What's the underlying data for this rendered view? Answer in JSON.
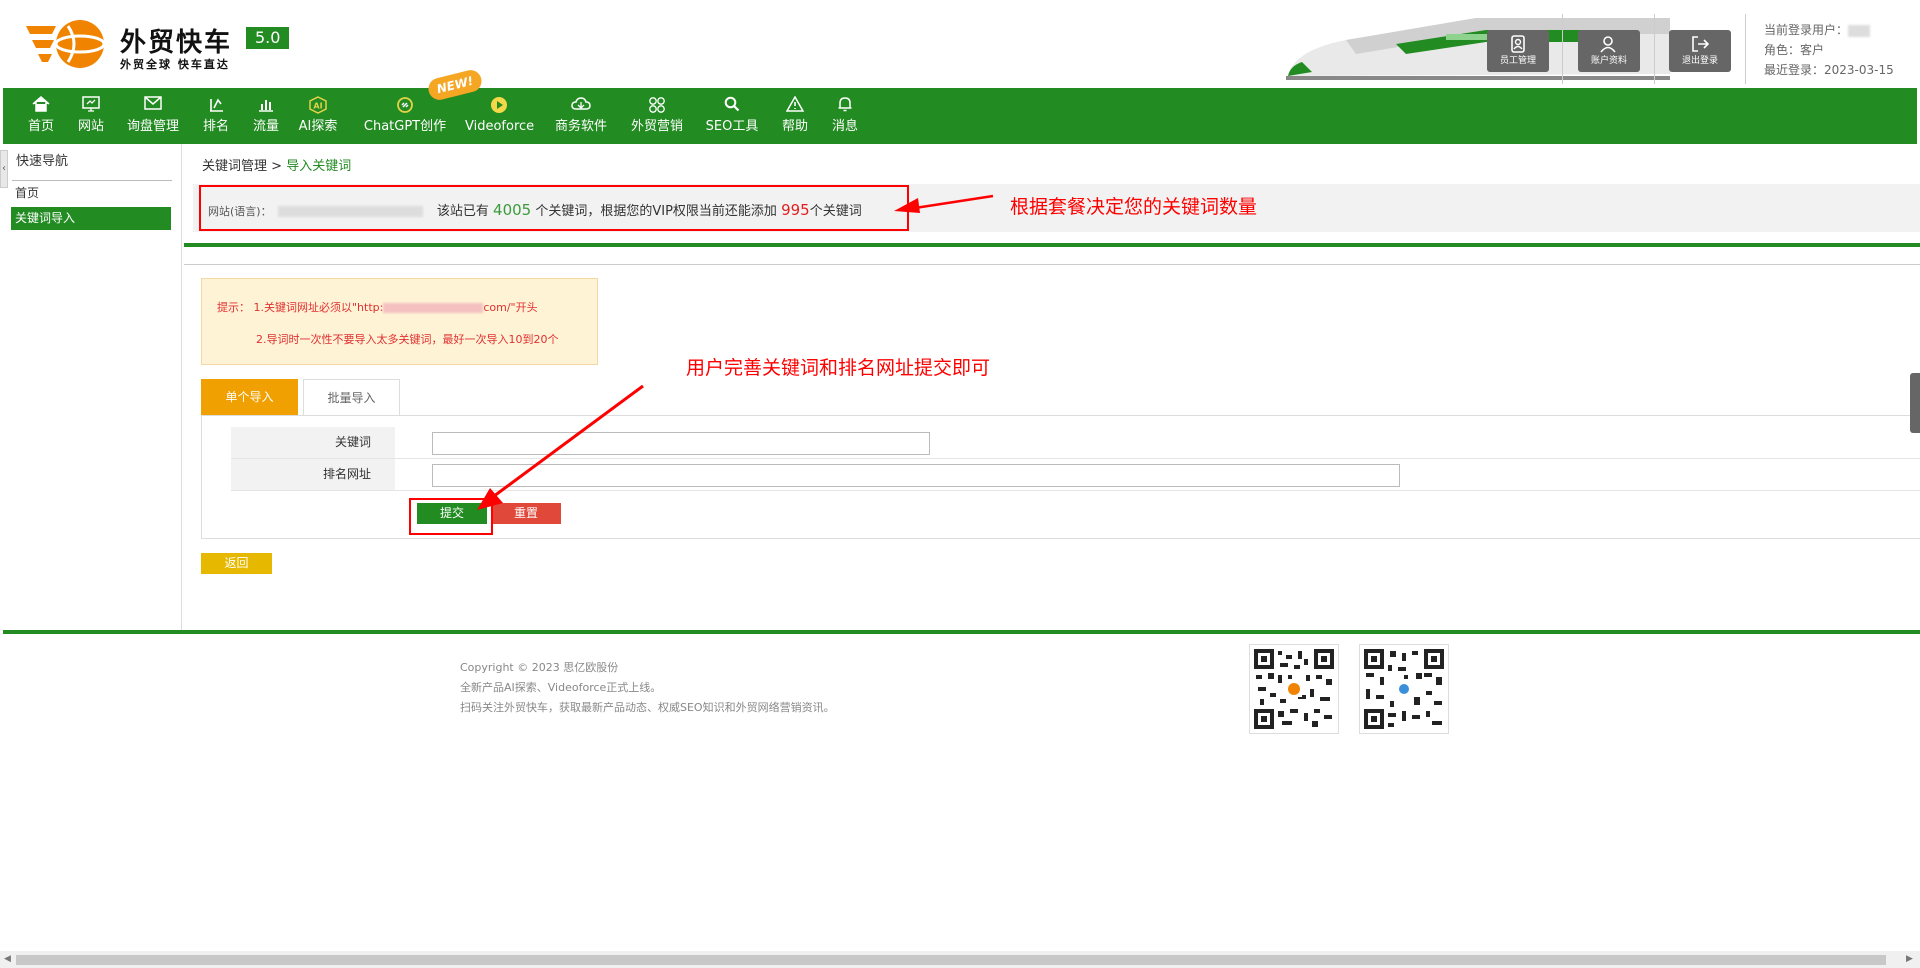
{
  "brand": {
    "name": "外贸快车",
    "tagline": "外贸全球 快车直达",
    "version": "5.0"
  },
  "header_buttons": [
    {
      "label": "员工管理",
      "icon": "staff-icon"
    },
    {
      "label": "账户资料",
      "icon": "user-icon"
    },
    {
      "label": "退出登录",
      "icon": "logout-icon"
    }
  ],
  "user_info": {
    "current_user_label": "当前登录用户：",
    "role_label": "角色：",
    "role": "客户",
    "last_login_label": "最近登录：",
    "last_login": "2023-03-15"
  },
  "nav": {
    "new_badge": "NEW!",
    "items": [
      {
        "label": "首页",
        "icon": "home-icon"
      },
      {
        "label": "网站",
        "icon": "monitor-icon"
      },
      {
        "label": "询盘管理",
        "icon": "mail-icon"
      },
      {
        "label": "排名",
        "icon": "ranking-icon"
      },
      {
        "label": "流量",
        "icon": "bar-chart-icon"
      },
      {
        "label": "AI探索",
        "icon": "ai-icon"
      },
      {
        "label": "ChatGPT创作",
        "icon": "chatgpt-icon"
      },
      {
        "label": "Videoforce",
        "icon": "play-icon"
      },
      {
        "label": "商务软件",
        "icon": "cloud-icon"
      },
      {
        "label": "外贸营销",
        "icon": "grid-icon"
      },
      {
        "label": "SEO工具",
        "icon": "search-icon"
      },
      {
        "label": "帮助",
        "icon": "warning-icon"
      },
      {
        "label": "消息",
        "icon": "bell-icon"
      }
    ]
  },
  "sidebar": {
    "title": "快速导航",
    "items": [
      {
        "label": "首页",
        "active": false
      },
      {
        "label": "关键词导入",
        "active": true
      }
    ]
  },
  "breadcrumb": {
    "parent": "关键词管理",
    "separator": ">",
    "current": "导入关键词"
  },
  "quota": {
    "site_label": "网站(语言)：",
    "text_before": "该站已有",
    "existing_count": "4005",
    "text_middle": "个关键词，根据您的VIP权限当前还能添加",
    "remaining_count": "995",
    "text_after": "个关键词"
  },
  "tips": {
    "line1_prefix": "提示：  1.关键词网址必须以\"http:",
    "line1_suffix": "com/\"开头",
    "line2": "2.导词时一次性不要导入太多关键词，最好一次导入10到20个"
  },
  "tabs": [
    {
      "label": "单个导入",
      "active": true
    },
    {
      "label": "批量导入",
      "active": false
    }
  ],
  "form": {
    "keyword_label": "关键词",
    "keyword_value": "",
    "url_label": "排名网址",
    "url_value": "",
    "submit_label": "提交",
    "reset_label": "重置",
    "back_label": "返回"
  },
  "annotations": {
    "quota_note": "根据套餐决定您的关键词数量",
    "form_note": "用户完善关键词和排名网址提交即可"
  },
  "footer": {
    "copyright": "Copyright © 2023 思亿欧股份",
    "line2": "全新产品AI探索、Videoforce正式上线。",
    "line3": "扫码关注外贸快车，获取最新产品动态、权威SEO知识和外贸网络营销资讯。"
  },
  "colors": {
    "brand_green": "#228b22",
    "brand_orange": "#f08300",
    "annotation_red": "#ff0000",
    "tab_active": "#f0a000",
    "reset_red": "#e0483a",
    "back_yellow": "#e6b800"
  }
}
